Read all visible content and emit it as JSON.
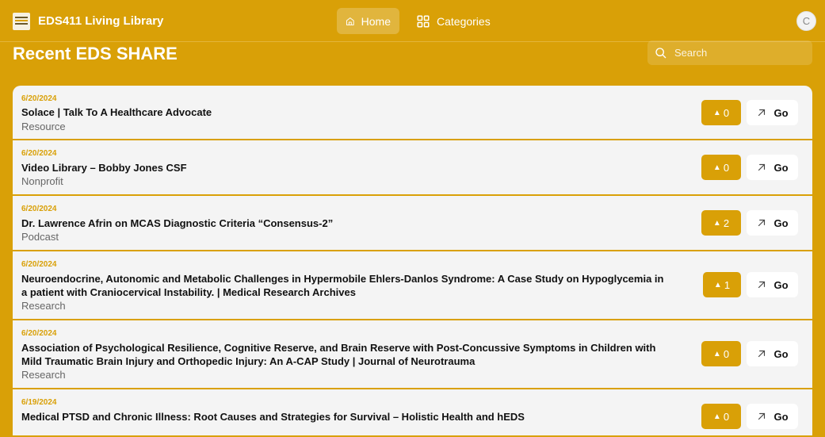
{
  "app": {
    "title": "EDS411 Living Library"
  },
  "nav": [
    {
      "label": "Home",
      "icon": "home-icon",
      "active": true
    },
    {
      "label": "Categories",
      "icon": "grid-icon",
      "active": false
    }
  ],
  "user": {
    "initial": "C"
  },
  "page": {
    "title": "Recent EDS SHARE"
  },
  "search": {
    "placeholder": "Search"
  },
  "colors": {
    "accent": "#d9a007",
    "card": "#f4f4f4"
  },
  "go_label": "Go",
  "items": [
    {
      "date": "6/20/2024",
      "title": "Solace | Talk To A Healthcare Advocate",
      "category": "Resource",
      "votes": "0"
    },
    {
      "date": "6/20/2024",
      "title": "Video Library – Bobby Jones CSF",
      "category": "Nonprofit",
      "votes": "0"
    },
    {
      "date": "6/20/2024",
      "title": "Dr. Lawrence Afrin on MCAS Diagnostic Criteria “Consensus-2”",
      "category": "Podcast",
      "votes": "2"
    },
    {
      "date": "6/20/2024",
      "title": "Neuroendocrine, Autonomic and Metabolic Challenges in Hypermobile Ehlers-Danlos Syndrome: A Case Study on Hypoglycemia in a patient with Craniocervical Instability. | Medical Research Archives",
      "category": "Research",
      "votes": "1"
    },
    {
      "date": "6/20/2024",
      "title": "Association of Psychological Resilience, Cognitive Reserve, and Brain Reserve with Post-Concussive Symptoms in Children with Mild Traumatic Brain Injury and Orthopedic Injury: An A-CAP Study | Journal of Neurotrauma",
      "category": "Research",
      "votes": "0"
    },
    {
      "date": "6/19/2024",
      "title": "Medical PTSD and Chronic Illness: Root Causes and Strategies for Survival – Holistic Health and hEDS",
      "category": "",
      "votes": "0"
    }
  ]
}
